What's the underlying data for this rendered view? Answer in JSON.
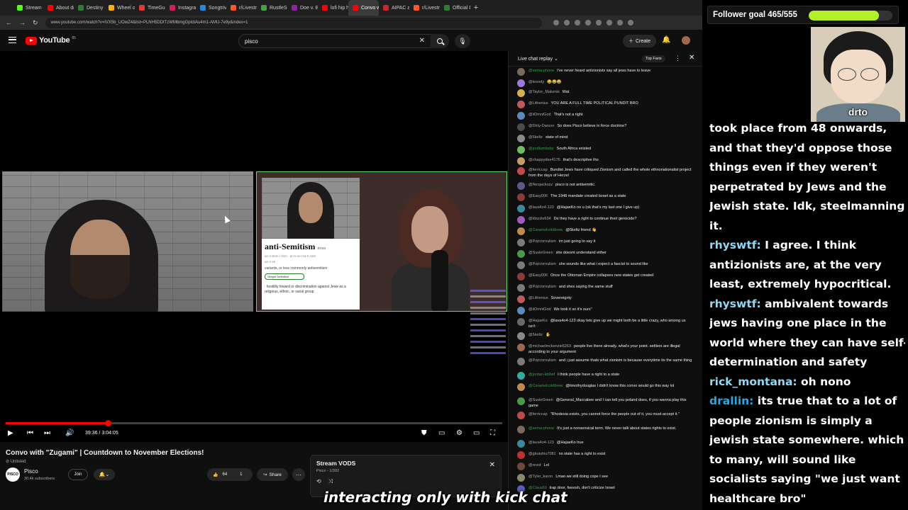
{
  "browser": {
    "tabs": [
      {
        "label": "Stream - Kick",
        "color": "#53fc18"
      },
      {
        "label": "About drt01",
        "color": "#ff0000"
      },
      {
        "label": "Destiny VoD",
        "color": "#2e7d32"
      },
      {
        "label": "Wheel of Na",
        "color": "#ffb300"
      },
      {
        "label": "TimeGuessr",
        "color": "#e53935"
      },
      {
        "label": "Instagram",
        "color": "#d81b60"
      },
      {
        "label": "Songtrivia: Fi",
        "color": "#1e88e5"
      },
      {
        "label": "r/Livestream",
        "color": "#ff5722"
      },
      {
        "label": "RustleSearch",
        "color": "#43a047"
      },
      {
        "label": "Doe v. Bonne",
        "color": "#8e24aa"
      },
      {
        "label": "lofi hip h",
        "color": "#ff0000"
      },
      {
        "label": "Convo wit",
        "color": "#ff0000",
        "active": true
      },
      {
        "label": "AIPAC and A",
        "color": "#c62828"
      },
      {
        "label": "r/Livestream",
        "color": "#ff5722"
      },
      {
        "label": "Official Destin",
        "color": "#2e7d32"
      }
    ],
    "new_tab": "+",
    "url": "www.youtube.com/watch?v=lVX5b_UOwZ4&list=PLNH5DDtTzWMbmgGpIdiAu4m1-AMU-7e9y&index=1"
  },
  "youtube": {
    "logo": "YouTube",
    "logo_cc": "85",
    "search_value": "pisco",
    "create_label": "Create",
    "player": {
      "progress": 0.205,
      "time": "39:36 / 3:04:05",
      "dictionary": {
        "word": "anti-Semitism",
        "pos": "noun",
        "pron1": "an·ti-Sem·i·tism  ·  an·ti-se·ma·ti·zam",
        "pron2": "an·ti·sē",
        "variants": "variants, or less commonly antisemitism",
        "toggle": "Simple Definition",
        "definition": ": hostility toward or discrimination against Jews as a religious, ethnic, or racial group"
      }
    },
    "video_title": "Convo with \"Zugami\" | Countdown to November Elections!",
    "unlisted": "Unlisted",
    "channel": {
      "name": "Pisco",
      "subs": "30.4k subscribers",
      "avatar_text": "PISCO"
    },
    "join_label": "Join",
    "likes": "64",
    "dislikes": "1",
    "share_label": "Share",
    "playlist": {
      "title": "Stream VODS",
      "sub": "Pisco - 1/392"
    }
  },
  "chat": {
    "mode": "Live chat replay",
    "filter": "Top Fans",
    "messages": [
      {
        "author": "@sema-phone",
        "text": "I've never heard antizionists say all jews have to leave",
        "member": true,
        "color": "#7a6a5a"
      },
      {
        "author": "@kroody",
        "text": "😂😂😂",
        "member": false,
        "color": "#9a7ad8"
      },
      {
        "author": "@Taylor_Makenis",
        "text": "Wat",
        "member": false,
        "color": "#d8b04a"
      },
      {
        "author": "@Lithenius",
        "text": "YOU ARE A FULL TIME POLITICAL PUNDIT BRO",
        "member": false,
        "color": "#c05a5a"
      },
      {
        "author": "@iiOmniGod",
        "text": "That's not a right",
        "member": false,
        "color": "#5a8ac0"
      },
      {
        "author": "@Dirty-Dancer",
        "text": "So does Pisco believe in force doctrine?",
        "member": false,
        "color": "#4a4a4a"
      },
      {
        "author": "@5keltz",
        "text": "state of mind",
        "member": false,
        "color": "#8a8a8a"
      },
      {
        "author": "@podiumbaby",
        "text": "South Africa existed",
        "member": true,
        "color": "#6ac05a"
      },
      {
        "author": "@chappydee4175",
        "text": "that's descriptive tho",
        "member": false,
        "color": "#c0a060"
      },
      {
        "author": "@ferriccap",
        "text": "Bundist Jews have critiqued Zionism and called the whole ethnonationalist project from the days of Herzel",
        "member": false,
        "color": "#c04a4a"
      },
      {
        "author": "@Neojackozz",
        "text": "pisco is not antisemitic.",
        "member": false,
        "color": "#5a5a8a"
      },
      {
        "author": "@Easy006",
        "text": "The 1948 mandate created Israel as a state",
        "member": false,
        "color": "#8a3a3a"
      },
      {
        "author": "@lava4o4-123",
        "text": "@HajaeKo no u (ok that's my last one I give up)",
        "member": false,
        "color": "#3a8a9a"
      },
      {
        "author": "@kbizzle634",
        "text": "Do they have a right to continue their genocide?",
        "member": false,
        "color": "#a05ac0"
      },
      {
        "author": "@Caramelcoldbrew",
        "text": "@5keltz friend 👋",
        "member": true,
        "color": "#c08a4a"
      },
      {
        "author": "@Popcornulism",
        "text": "im just going to say it",
        "member": false,
        "color": "#7a7a7a"
      },
      {
        "author": "@SuvieGreen",
        "text": "she doesnt understand either",
        "member": false,
        "color": "#4a9a4a"
      },
      {
        "author": "@Popcornulism",
        "text": "she sounds like what i expect a fascist to sound like",
        "member": false,
        "color": "#7a7a7a"
      },
      {
        "author": "@Easy006",
        "text": "Once the Ottoman Empire collapses new states get created",
        "member": false,
        "color": "#8a3a3a"
      },
      {
        "author": "@Popcornulism",
        "text": "and shes saying the same stuff",
        "member": false,
        "color": "#7a7a7a"
      },
      {
        "author": "@Lithenius",
        "text": "Sovereignty",
        "member": false,
        "color": "#c05a5a"
      },
      {
        "author": "@iiOmniGod",
        "text": "We took it so it's ours\"",
        "member": false,
        "color": "#5a8ac0"
      },
      {
        "author": "@HajaeKo",
        "text": "@lava4o4-123 okay lets give up we might both be a little crazy, who among us isn't",
        "member": false,
        "color": "#6a6a6a"
      },
      {
        "author": "@5keltz",
        "text": "✋",
        "member": false,
        "color": "#8a8a8a"
      },
      {
        "author": "@michaelmckenzie6263",
        "text": "people live there already. what's your point. settlers are illegal according to your argument",
        "member": false,
        "color": "#9a6a4a"
      },
      {
        "author": "@Popcornulism",
        "text": "and i just assume thats what zionism is because everytime its the same thing",
        "member": false,
        "color": "#7a7a7a"
      },
      {
        "author": "@jordan-kb9wf",
        "text": "I think people have a right to a state",
        "member": true,
        "color": "#2ab0a0"
      },
      {
        "author": "@Caramelcoldbrew",
        "text": "@timothydouglas I didn't know this convo would go this way lol",
        "member": true,
        "color": "#c08a4a"
      },
      {
        "author": "@SuvieGreen",
        "text": "@General_Maccabee and I can tell you poland does, if you wanna play this game",
        "member": false,
        "color": "#4a9a4a"
      },
      {
        "author": "@ferriccap",
        "text": "\"Rhodesia exists, you cannot force the people out of it, you must accept it.\"",
        "member": false,
        "color": "#c04a4a"
      },
      {
        "author": "@sema-phone",
        "text": "It's just a nonsensical term. We never talk about states rights to exist.",
        "member": true,
        "color": "#7a6a5a"
      },
      {
        "author": "@lava4o4-123",
        "text": "@HajaeKo true",
        "member": false,
        "color": "#3a8a9a"
      },
      {
        "author": "@gbuiuhiu7081",
        "text": "no state has a right to exist",
        "member": false,
        "color": "#c03030"
      },
      {
        "author": "@revid",
        "text": "Lol",
        "member": false,
        "color": "#6a4a3a"
      },
      {
        "author": "@Tyler_karon",
        "text": "Lmao we still doing cope I see",
        "member": false,
        "color": "#8a8a6a"
      },
      {
        "author": "@Claus69",
        "text": "trap door, fwoosh, don't criticize Israel",
        "member": true,
        "color": "#5a5ac0"
      }
    ]
  },
  "overlay": {
    "follower_goal_label": "Follower goal 465/555",
    "follower_goal_fraction": 0.838,
    "avatar_name": "drto",
    "lines": [
      {
        "user": "",
        "text": "took place from 48 onwards,"
      },
      {
        "user": "",
        "text": "and that they'd oppose those"
      },
      {
        "user": "",
        "text": "things even if they weren't"
      },
      {
        "user": "",
        "text": "perpetrated by Jews and the"
      },
      {
        "user": "",
        "text": "Jewish state. Idk, steelmanning"
      },
      {
        "user": "",
        "text": "it."
      },
      {
        "user": "rhyswtf:",
        "text": " I agree. I think"
      },
      {
        "user": "",
        "text": "antizionists are, at the very"
      },
      {
        "user": "",
        "text": "least, extremely hypocritical."
      },
      {
        "user": "rhyswtf:",
        "text": " ambivalent towards"
      },
      {
        "user": "",
        "text": "jews having one place in the"
      },
      {
        "user": "",
        "text": "world where they can have self-"
      },
      {
        "user": "",
        "text": "determination and safety"
      },
      {
        "user": "rick_montana:",
        "text": " oh nono"
      },
      {
        "user2": "drallin:",
        "text": " its true that to a lot of"
      },
      {
        "user": "",
        "text": "people zionism is simply a"
      },
      {
        "user": "",
        "text": "jewish state somewhere. which"
      },
      {
        "user": "",
        "text": "to many, will sound like"
      },
      {
        "user": "",
        "text": "socialists saying \"we just want"
      },
      {
        "user": "",
        "text": "healthcare bro\""
      }
    ]
  },
  "caption": "interacting only with kick chat"
}
